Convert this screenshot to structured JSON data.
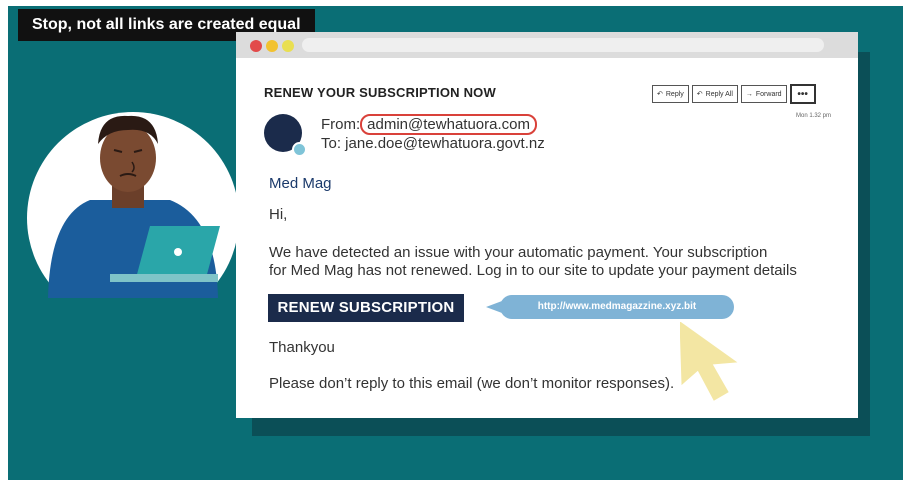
{
  "caption": "Stop, not all links are created equal",
  "colors": {
    "teal": "#0a6e75",
    "navy": "#1b2b4b",
    "highlight": "#d9413a",
    "tooltip": "#7fb3d6",
    "cursor": "#f3e6a3"
  },
  "email": {
    "subject": "RENEW YOUR SUBSCRIPTION NOW",
    "from_label": "From:",
    "from_address": "admin@tewhatuora.com",
    "to": "To: jane.doe@tewhatuora.govt.nz",
    "time": "Mon 1.32 pm",
    "sender_name": "Med Mag",
    "greeting": "Hi,",
    "paragraph_line1": "We have detected an issue with your automatic payment. Your subscription",
    "paragraph_line2": "for Med Mag has not renewed. Log in to our site to update your payment details",
    "button_label": "RENEW SUBSCRIPTION",
    "link_tooltip": "http://www.medmagazzine.xyz.bit",
    "thanks": "Thankyou",
    "footer": "Please don’t reply to this email (we don’t monitor responses)."
  },
  "toolbar": {
    "reply": "Reply",
    "reply_all": "Reply All",
    "forward": "Forward",
    "more": "•••"
  },
  "icons": [
    "reply-icon",
    "reply-all-icon",
    "forward-icon",
    "more-icon",
    "cursor-icon",
    "laptop-icon"
  ]
}
